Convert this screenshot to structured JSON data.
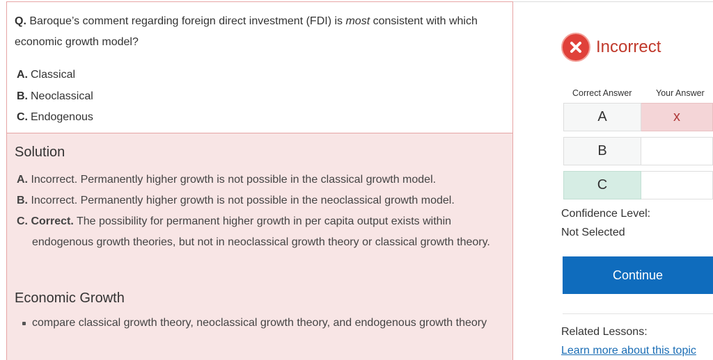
{
  "question": {
    "prefix": "Q.",
    "text_part1": "Baroque’s comment regarding foreign direct investment (FDI) is ",
    "emphasis": "most",
    "text_part2": " consistent with which economic growth model?",
    "options": [
      {
        "letter": "A.",
        "text": "Classical"
      },
      {
        "letter": "B.",
        "text": "Neoclassical"
      },
      {
        "letter": "C.",
        "text": "Endogenous"
      }
    ]
  },
  "solution": {
    "title": "Solution",
    "items": [
      {
        "letter": "A.",
        "verdict": "Incorrect.",
        "text": "Permanently higher growth is not possible in the classical growth model."
      },
      {
        "letter": "B.",
        "verdict": "Incorrect.",
        "text": "Permanently higher growth is not possible in the neoclassical growth model."
      },
      {
        "letter": "C.",
        "verdict": "Correct.",
        "text_line1": "The possibility for permanent higher growth in per capita output exists within",
        "text_rest": "endogenous growth theories, but not in neoclassical growth theory or classical growth theory."
      }
    ]
  },
  "learning_outcome": {
    "title": "Economic Growth",
    "items": [
      "compare classical growth theory, neoclassical growth theory, and endogenous growth theory"
    ]
  },
  "result": {
    "status": "Incorrect",
    "status_icon": "x-circle-icon",
    "status_color": "#e0413a",
    "header_correct": "Correct Answer",
    "header_yours": "Your Answer",
    "rows": [
      {
        "choice": "A",
        "your_mark": "x"
      },
      {
        "choice": "B",
        "your_mark": ""
      },
      {
        "choice": "C",
        "your_mark": ""
      }
    ],
    "correct_choice": "C",
    "your_choice": "A",
    "confidence_label": "Confidence Level:",
    "confidence_value": "Not Selected",
    "continue_label": "Continue",
    "accent_color": "#0f6cbd",
    "related_label": "Related Lessons:",
    "related_link": "Learn more about this topic"
  }
}
